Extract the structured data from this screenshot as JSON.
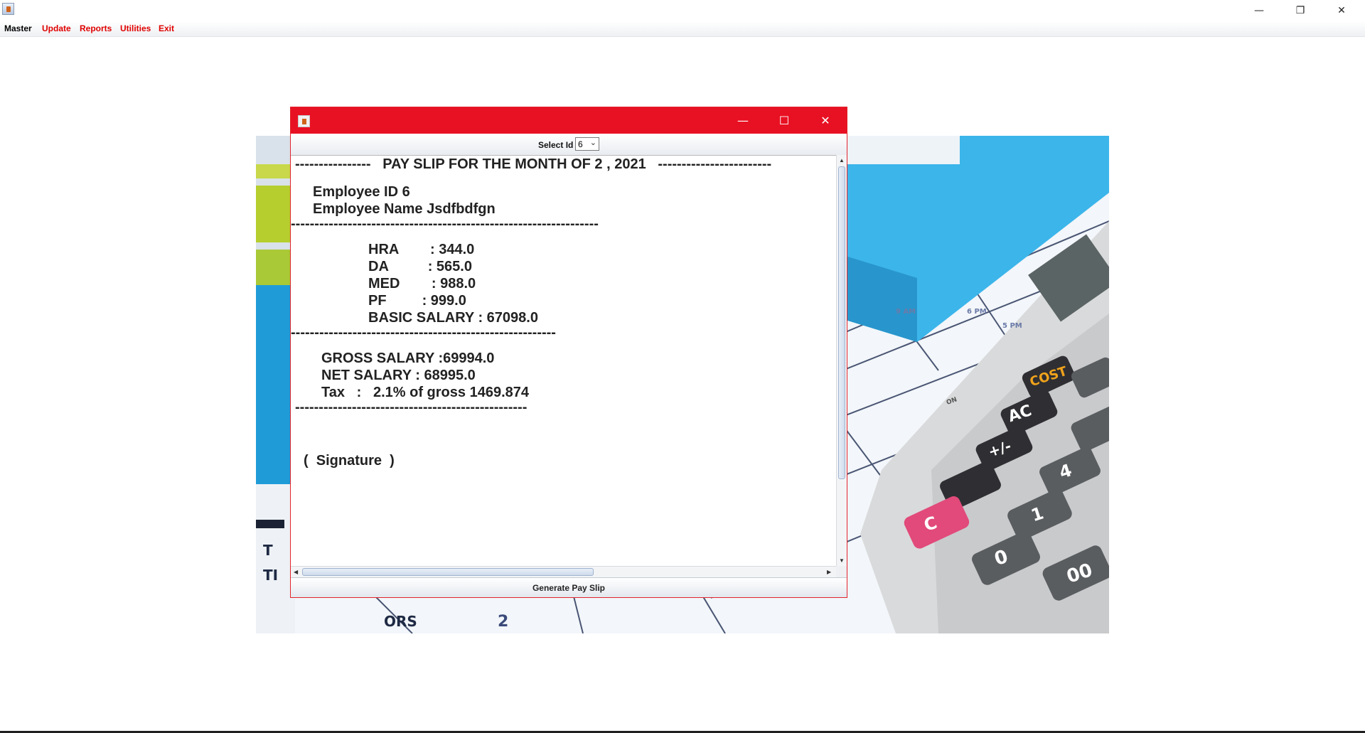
{
  "window": {
    "controls": {
      "minimize": "—",
      "restore": "❐",
      "close": "✕"
    }
  },
  "menubar": {
    "items": [
      "Master",
      "Update",
      "Reports",
      "Utilities",
      "Exit"
    ],
    "colors": {
      "master": "#000000",
      "others": "#e00000"
    }
  },
  "dialog": {
    "title_bar_color": "#e81123",
    "controls": {
      "minimize": "—",
      "maximize": "☐",
      "close": "✕"
    },
    "select_label": "Select Id",
    "select_value": "6",
    "payslip": {
      "header": "----------------   PAY SLIP FOR THE MONTH OF 2 , 2021   ------------------------",
      "employee_id": "Employee ID 6",
      "employee_name": "Employee Name Jsdfbdfgn",
      "divider1": "-----------------------------------------------------------------",
      "hra": "HRA        : 344.0",
      "da": "DA          : 565.0",
      "med": "MED        : 988.0",
      "pf": "PF         : 999.0",
      "basic": "BASIC SALARY : 67098.0",
      "divider2": "--------------------------------------------------------",
      "gross": "GROSS SALARY :69994.0",
      "net": "NET SALARY : 68995.0",
      "tax": "Tax   :   2.1% of gross 1469.874",
      "divider3": "-------------------------------------------------",
      "signature": "(  Signature  )"
    },
    "generate_button": "Generate Pay Slip"
  }
}
